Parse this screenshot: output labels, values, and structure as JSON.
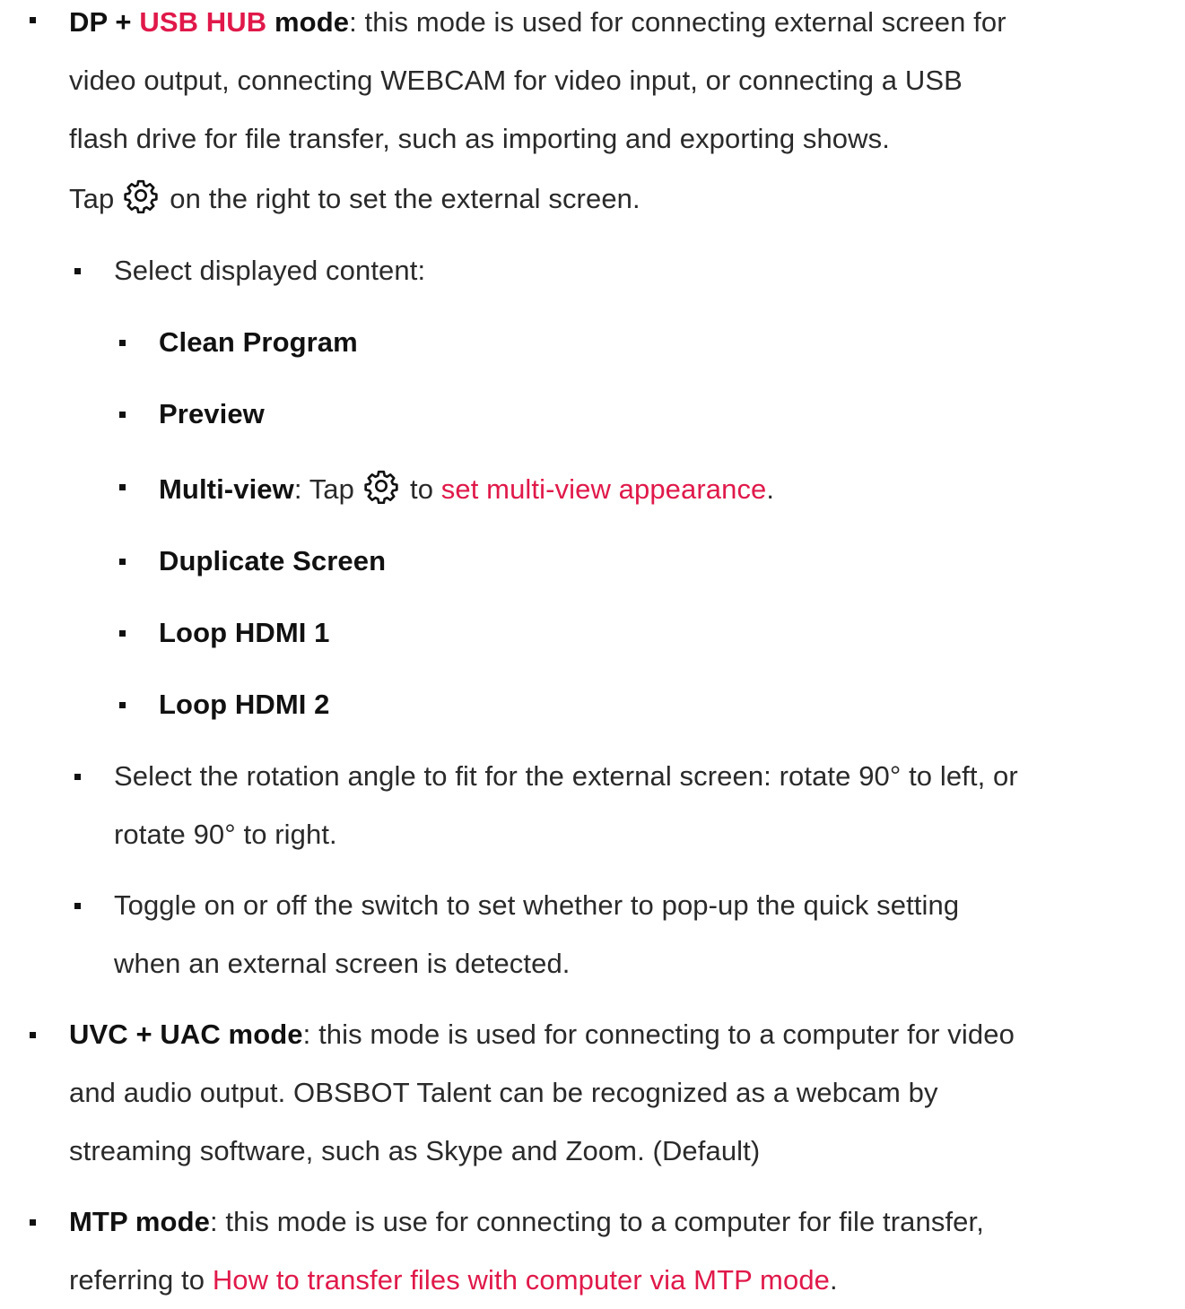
{
  "dp_usb": {
    "title_a": "DP + ",
    "title_link": "USB HUB",
    "title_b": " mode",
    "desc": ": this mode is used for connecting external screen for",
    "line2": "video output, connecting WEBCAM for video input, or connecting a USB",
    "line3": "flash drive for file transfer, such as importing and exporting shows.",
    "tap_prefix": "Tap",
    "tap_suffix": "on the right to set the external screen.",
    "gear_icon": "gear-icon"
  },
  "display_content": {
    "label": "Select displayed content:",
    "options": {
      "clean_program": "Clean Program",
      "preview": "Preview",
      "multiview_label": "Multi-view",
      "multiview_tap": ": Tap",
      "multiview_to": "to",
      "multiview_link": "set multi-view appearance",
      "multiview_end": ".",
      "duplicate": "Duplicate Screen",
      "loop1": "Loop HDMI 1",
      "loop2": "Loop HDMI 2"
    }
  },
  "rotation": {
    "line1": "Select the rotation angle to fit for the external screen: rotate 90° to left, or",
    "line2": "rotate 90° to right."
  },
  "popup": {
    "line1": "Toggle on or off the switch to set whether to pop-up the quick setting",
    "line2": "when an external screen is detected."
  },
  "uvc": {
    "title": "UVC + UAC mode",
    "desc": ": this mode is used for connecting to a computer for video",
    "line2": "and audio output. OBSBOT Talent can be recognized as a webcam by",
    "line3": "streaming software, such as Skype and Zoom. (Default)"
  },
  "mtp": {
    "title": "MTP mode",
    "desc": ": this mode is use for connecting to a computer for file transfer,",
    "line2_prefix": "referring to ",
    "line2_link": "How to transfer files with computer via MTP mode",
    "line2_end": "."
  },
  "colors": {
    "link": "#e0194a",
    "text": "#2a2a2a"
  }
}
